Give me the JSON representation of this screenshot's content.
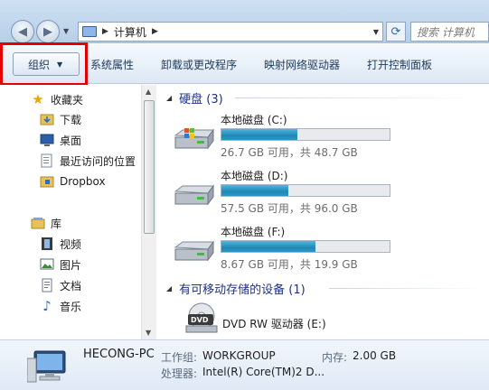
{
  "address_bar": {
    "path_segment": "计算机",
    "search_placeholder": "搜索 计算机"
  },
  "toolbar": {
    "organize": "组织",
    "items": [
      "系统属性",
      "卸载或更改程序",
      "映射网络驱动器",
      "打开控制面板"
    ]
  },
  "nav": {
    "favorites_header": "收藏夹",
    "favorites": [
      "下载",
      "桌面",
      "最近访问的位置",
      "Dropbox"
    ],
    "library_header": "库",
    "libraries": [
      "视频",
      "图片",
      "文档",
      "音乐"
    ]
  },
  "content": {
    "hard_disks_header": "硬盘 (3)",
    "drives": [
      {
        "name": "本地磁盘 (C:)",
        "info": "26.7 GB 可用，共 48.7 GB",
        "used_fraction": 0.45
      },
      {
        "name": "本地磁盘 (D:)",
        "info": "57.5 GB 可用，共 96.0 GB",
        "used_fraction": 0.4
      },
      {
        "name": "本地磁盘 (F:)",
        "info": "8.67 GB 可用，共 19.9 GB",
        "used_fraction": 0.56
      }
    ],
    "removable_header": "有可移动存储的设备 (1)",
    "dvd_name": "DVD RW 驱动器 (E:)",
    "dvd_badge": "DVD"
  },
  "details": {
    "computer_name": "HECONG-PC",
    "workgroup_label": "工作组:",
    "workgroup_value": "WORKGROUP",
    "memory_label": "内存:",
    "memory_value": "2.00 GB",
    "processor_label": "处理器:",
    "processor_value": "Intel(R) Core(TM)2 D..."
  },
  "colors": {
    "highlight_border": "#e20000",
    "drive_bar": "#1e88b8",
    "group_header": "#1e3287"
  }
}
